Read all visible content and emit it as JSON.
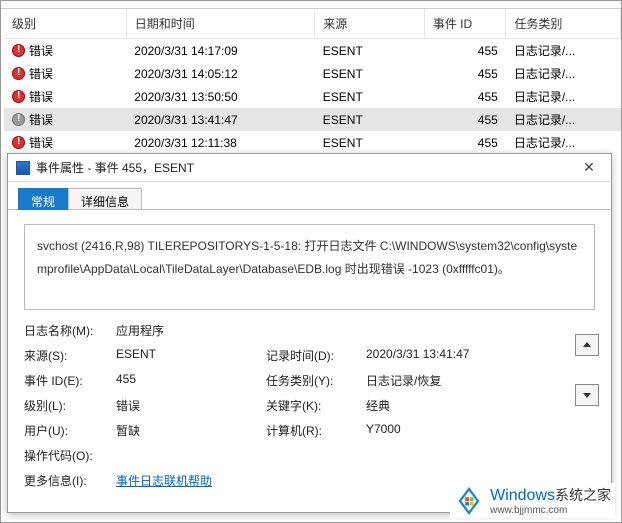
{
  "table": {
    "headers": {
      "level": "级别",
      "datetime": "日期和时间",
      "source": "来源",
      "eventid": "事件 ID",
      "taskcat": "任务类别"
    },
    "rows": [
      {
        "level": "错误",
        "datetime": "2020/3/31 14:17:09",
        "source": "ESENT",
        "eventid": "455",
        "taskcat": "日志记录/...",
        "icon": "error"
      },
      {
        "level": "错误",
        "datetime": "2020/3/31 14:05:12",
        "source": "ESENT",
        "eventid": "455",
        "taskcat": "日志记录/...",
        "icon": "error"
      },
      {
        "level": "错误",
        "datetime": "2020/3/31 13:50:50",
        "source": "ESENT",
        "eventid": "455",
        "taskcat": "日志记录/...",
        "icon": "error"
      },
      {
        "level": "错误",
        "datetime": "2020/3/31 13:41:47",
        "source": "ESENT",
        "eventid": "455",
        "taskcat": "日志记录/...",
        "icon": "error-grey",
        "selected": true
      },
      {
        "level": "错误",
        "datetime": "2020/3/31 12:11:38",
        "source": "ESENT",
        "eventid": "455",
        "taskcat": "日志记录/...",
        "icon": "error"
      }
    ]
  },
  "modal": {
    "title": "事件属性 - 事件 455，ESENT",
    "tabs": {
      "general": "常规",
      "details": "详细信息"
    },
    "message": "svchost (2416,R,98) TILEREPOSITORYS-1-5-18: 打开日志文件 C:\\WINDOWS\\system32\\config\\systemprofile\\AppData\\Local\\TileDataLayer\\Database\\EDB.log 时出现错误 -1023 (0xfffffc01)。",
    "fields": {
      "logname_label": "日志名称(M):",
      "logname_value": "应用程序",
      "source_label": "来源(S):",
      "source_value": "ESENT",
      "logged_label": "记录时间(D):",
      "logged_value": "2020/3/31 13:41:47",
      "eventid_label": "事件 ID(E):",
      "eventid_value": "455",
      "taskcat_label": "任务类别(Y):",
      "taskcat_value": "日志记录/恢复",
      "level_label": "级别(L):",
      "level_value": "错误",
      "keywords_label": "关键字(K):",
      "keywords_value": "经典",
      "user_label": "用户(U):",
      "user_value": "暂缺",
      "computer_label": "计算机(R):",
      "computer_value": "Y7000",
      "opcode_label": "操作代码(O):",
      "opcode_value": "",
      "moreinfo_label": "更多信息(I):",
      "moreinfo_link": "事件日志联机帮助"
    }
  },
  "footer": {
    "brand1": "Windows",
    "brand2": "系统之家",
    "url": "www.bjjmmc.com"
  }
}
